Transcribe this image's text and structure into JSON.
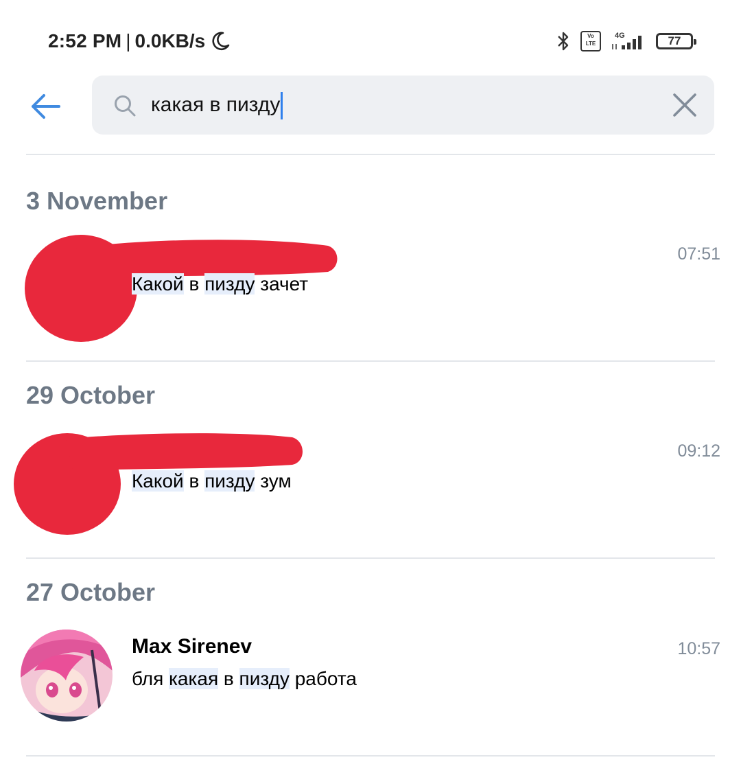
{
  "status_bar": {
    "time": "2:52 PM",
    "separator": "|",
    "speed": "0.0KB/s",
    "icons": [
      "moon-icon",
      "bluetooth-icon",
      "volte-icon",
      "4g-signal-icon",
      "battery-icon"
    ],
    "volte_top": "Vo",
    "volte_bottom": "LTE",
    "network": "4G",
    "battery": "77"
  },
  "search": {
    "query": "какая в пизду"
  },
  "results": [
    {
      "date": "3 November",
      "time": "07:51",
      "name": "",
      "text_parts": [
        {
          "text": "Какой",
          "hl": true
        },
        {
          "text": " в ",
          "hl": false
        },
        {
          "text": "пизду",
          "hl": true
        },
        {
          "text": " зачет",
          "hl": false
        }
      ]
    },
    {
      "date": "29 October",
      "time": "09:12",
      "name": "",
      "text_parts": [
        {
          "text": "Какой",
          "hl": true
        },
        {
          "text": " в ",
          "hl": false
        },
        {
          "text": "пизду",
          "hl": true
        },
        {
          "text": " зум",
          "hl": false
        }
      ]
    },
    {
      "date": "27 October",
      "time": "10:57",
      "name": "Max Sirenev",
      "text_parts": [
        {
          "text": "бля ",
          "hl": false
        },
        {
          "text": "какая",
          "hl": true
        },
        {
          "text": " в ",
          "hl": false
        },
        {
          "text": "пизду",
          "hl": true
        },
        {
          "text": " работа",
          "hl": false
        }
      ]
    }
  ],
  "colors": {
    "accent": "#2f80ed",
    "date_text": "#6d7885",
    "time_text": "#818c99",
    "highlight": "#e6eefb",
    "redaction": "#e8283c",
    "search_bg": "#eef0f3"
  }
}
